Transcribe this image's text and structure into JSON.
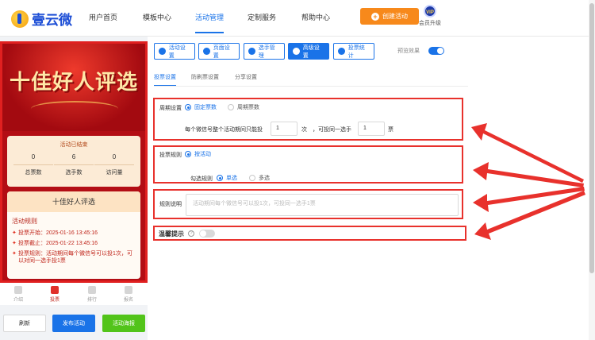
{
  "brand": {
    "name": "壹云微"
  },
  "nav": {
    "items": [
      {
        "label": "用户首页",
        "active": false
      },
      {
        "label": "模板中心",
        "active": false
      },
      {
        "label": "活动管理",
        "active": true
      },
      {
        "label": "定制服务",
        "active": false
      },
      {
        "label": "帮助中心",
        "active": false
      }
    ],
    "create_button": "创建活动",
    "vip_badge": "VIP",
    "vip_label": "会员升级"
  },
  "preview": {
    "banner_title": "十佳好人评选",
    "status": "活动已结束",
    "stats": [
      {
        "value": "0",
        "label": "总票数"
      },
      {
        "value": "6",
        "label": "选手数"
      },
      {
        "value": "0",
        "label": "访问量"
      }
    ],
    "card_title": "十佳好人评选",
    "rules_heading": "活动规则",
    "rules": [
      "投票开始：2025-01-16 13:45:16",
      "投票截止：2025-01-22 13:45:16",
      "投票规则：活动期间每个微信号可以投1次，可以对同一选手投1票"
    ],
    "tabs": [
      {
        "label": "介绍",
        "active": false
      },
      {
        "label": "投票",
        "active": true
      },
      {
        "label": "排行",
        "active": false
      },
      {
        "label": "报名",
        "active": false
      }
    ]
  },
  "actions": {
    "refresh": "刷新",
    "publish": "发布活动",
    "poster": "活动海报"
  },
  "toolbar": {
    "buttons": [
      {
        "label": "活动设置",
        "active": false
      },
      {
        "label": "页面设置",
        "active": false
      },
      {
        "label": "选手管理",
        "active": false
      },
      {
        "label": "高级设置",
        "active": true
      },
      {
        "label": "投票统计",
        "active": false
      }
    ],
    "preview_label": "预览效果",
    "preview_enabled": true
  },
  "subtabs": [
    {
      "label": "投票设置",
      "active": true
    },
    {
      "label": "防刷票设置",
      "active": false
    },
    {
      "label": "分享设置",
      "active": false
    }
  ],
  "settings": {
    "cycle": {
      "label": "周期设置",
      "options": [
        "固定票数",
        "周期票数"
      ],
      "selected": "固定票数",
      "limit_prefix": "每个微信号整个活动期间只能投",
      "limit_value": "1",
      "limit_unit": "次",
      "per_candidate_prefix": "，可投同一选手",
      "per_candidate_value": "1",
      "per_candidate_unit": "票"
    },
    "rule": {
      "label": "投票规则",
      "option": "按活动",
      "check_label": "勾选规则",
      "check_options": [
        "单选",
        "多选"
      ],
      "check_selected": "单选"
    },
    "description": {
      "label": "规则说明",
      "placeholder": "活动期间每个微信号可以投1次，可投同一选手1票"
    },
    "reminder": {
      "label": "温馨提示",
      "help": "?",
      "enabled": false
    }
  },
  "colors": {
    "primary": "#1a73e8",
    "highlight": "#e8312c",
    "create": "#f7891b",
    "poster": "#52c41a"
  }
}
